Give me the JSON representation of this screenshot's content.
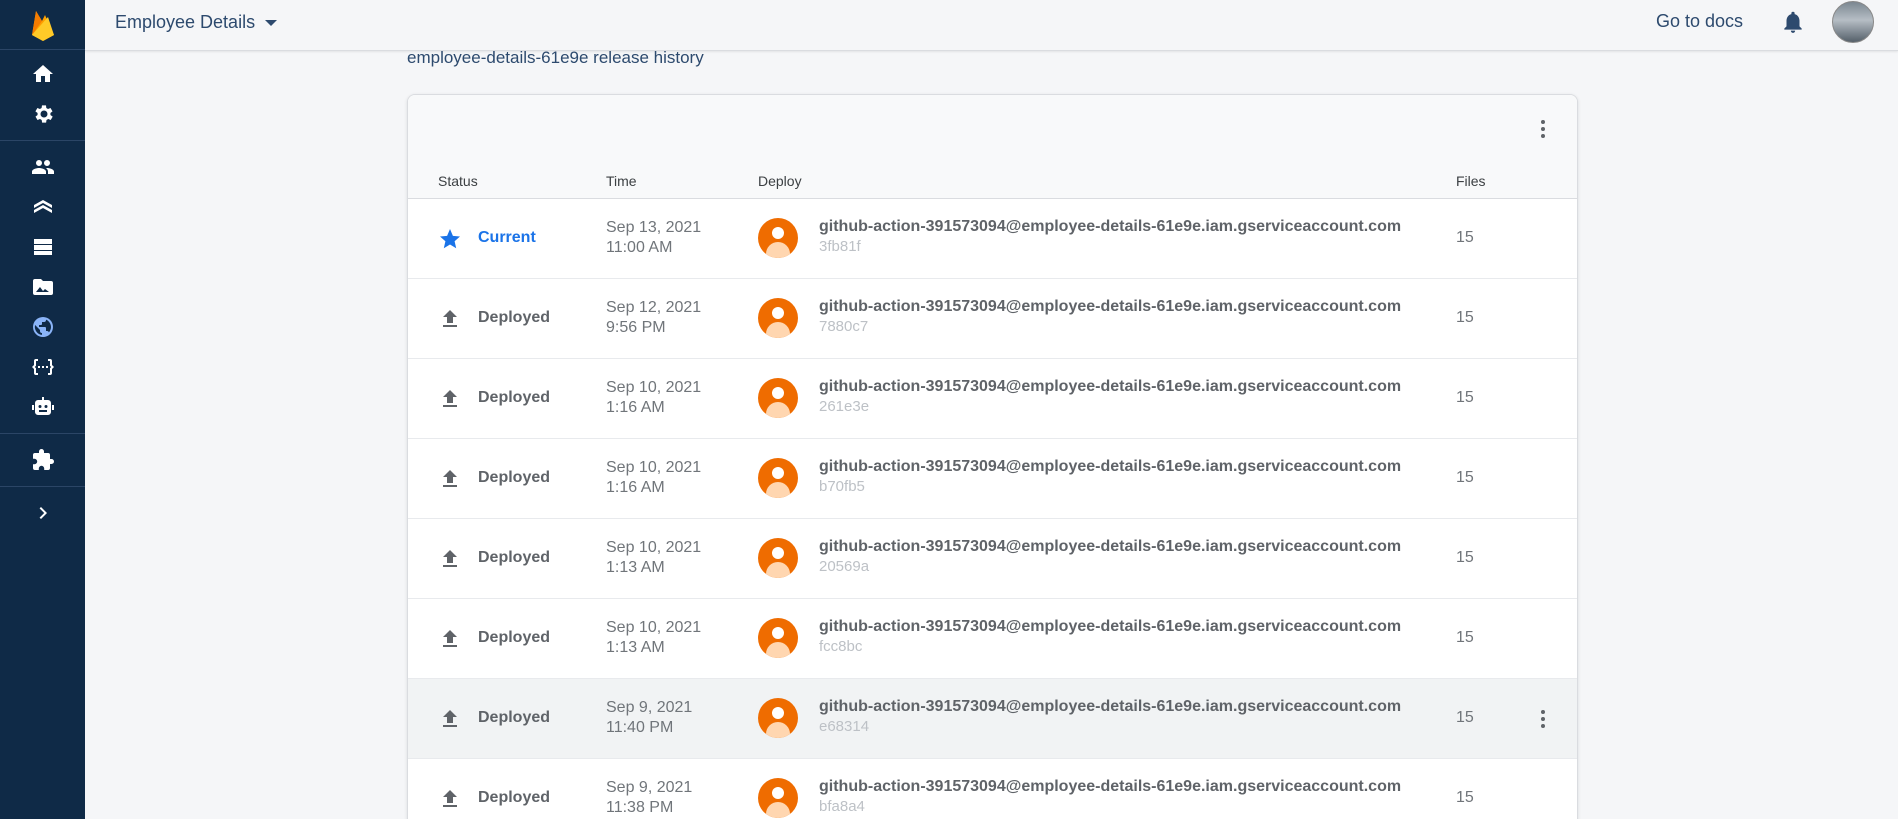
{
  "app": {
    "project_name": "Employee Details",
    "go_to_docs": "Go to docs"
  },
  "sidebar": {
    "items": [
      {
        "name": "home-icon"
      },
      {
        "name": "settings-icon"
      },
      {
        "name": "authentication-icon"
      },
      {
        "name": "firestore-icon"
      },
      {
        "name": "realtime-database-icon"
      },
      {
        "name": "storage-icon"
      },
      {
        "name": "hosting-icon",
        "active": true
      },
      {
        "name": "functions-icon"
      },
      {
        "name": "ml-icon"
      },
      {
        "name": "extensions-icon"
      },
      {
        "name": "expand-icon"
      }
    ]
  },
  "history": {
    "title": "employee-details-61e9e release history",
    "columns": {
      "status": "Status",
      "time": "Time",
      "deploy": "Deploy",
      "files": "Files"
    },
    "rows": [
      {
        "status": "Current",
        "date": "Sep 13, 2021",
        "clock": "11:00 AM",
        "email": "github-action-391573094@employee-details-61e9e.iam.gserviceaccount.com",
        "hash": "3fb81f",
        "files": "15"
      },
      {
        "status": "Deployed",
        "date": "Sep 12, 2021",
        "clock": "9:56 PM",
        "email": "github-action-391573094@employee-details-61e9e.iam.gserviceaccount.com",
        "hash": "7880c7",
        "files": "15"
      },
      {
        "status": "Deployed",
        "date": "Sep 10, 2021",
        "clock": "1:16 AM",
        "email": "github-action-391573094@employee-details-61e9e.iam.gserviceaccount.com",
        "hash": "261e3e",
        "files": "15"
      },
      {
        "status": "Deployed",
        "date": "Sep 10, 2021",
        "clock": "1:16 AM",
        "email": "github-action-391573094@employee-details-61e9e.iam.gserviceaccount.com",
        "hash": "b70fb5",
        "files": "15"
      },
      {
        "status": "Deployed",
        "date": "Sep 10, 2021",
        "clock": "1:13 AM",
        "email": "github-action-391573094@employee-details-61e9e.iam.gserviceaccount.com",
        "hash": "20569a",
        "files": "15"
      },
      {
        "status": "Deployed",
        "date": "Sep 10, 2021",
        "clock": "1:13 AM",
        "email": "github-action-391573094@employee-details-61e9e.iam.gserviceaccount.com",
        "hash": "fcc8bc",
        "files": "15"
      },
      {
        "status": "Deployed",
        "date": "Sep 9, 2021",
        "clock": "11:40 PM",
        "email": "github-action-391573094@employee-details-61e9e.iam.gserviceaccount.com",
        "hash": "e68314",
        "files": "15"
      },
      {
        "status": "Deployed",
        "date": "Sep 9, 2021",
        "clock": "11:38 PM",
        "email": "github-action-391573094@employee-details-61e9e.iam.gserviceaccount.com",
        "hash": "bfa8a4",
        "files": "15"
      }
    ]
  },
  "colors": {
    "sidebar": "#0f2a47",
    "accent": "#1a73e8",
    "avatar": "#ef6c00"
  }
}
